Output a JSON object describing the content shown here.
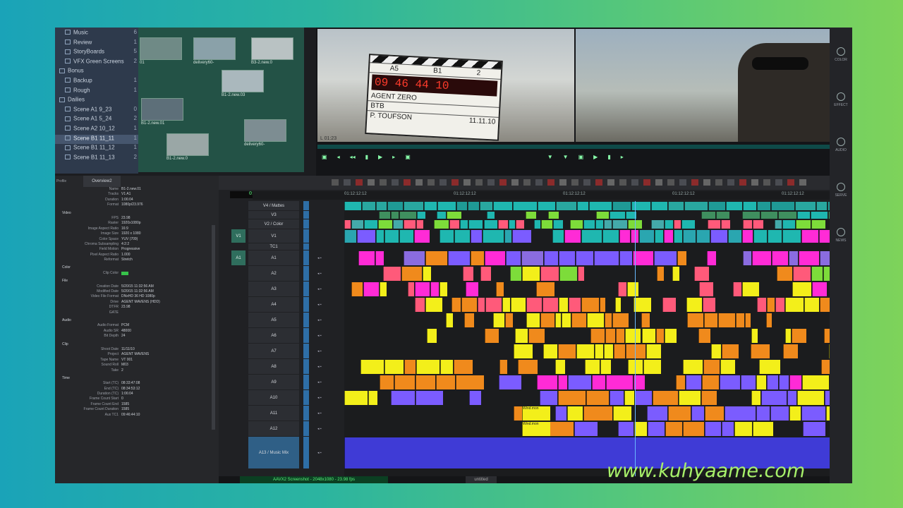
{
  "bins": {
    "items": [
      {
        "label": "Music",
        "count": "6",
        "indent": 1
      },
      {
        "label": "Review",
        "count": "1",
        "indent": 1
      },
      {
        "label": "StoryBoards",
        "count": "5",
        "indent": 1
      },
      {
        "label": "VFX Green Screens",
        "count": "2",
        "indent": 1
      },
      {
        "label": "Bonus",
        "count": "",
        "indent": 0
      },
      {
        "label": "Backup",
        "count": "1",
        "indent": 1
      },
      {
        "label": "Rough",
        "count": "1",
        "indent": 1
      },
      {
        "label": "Dailies",
        "count": "",
        "indent": 0
      },
      {
        "label": "Scene A1 9_23",
        "count": "0",
        "indent": 1
      },
      {
        "label": "Scene A1 5_24",
        "count": "2",
        "indent": 1
      },
      {
        "label": "Scene A2 10_12",
        "count": "1",
        "indent": 1
      },
      {
        "label": "Scene B1 11_11",
        "count": "1",
        "indent": 1,
        "selected": true
      },
      {
        "label": "Scene B1 11_12",
        "count": "1",
        "indent": 1
      },
      {
        "label": "Scene B1 11_13",
        "count": "2",
        "indent": 1
      }
    ]
  },
  "thumbs": [
    {
      "caption": "01"
    },
    {
      "caption": "delivery60-"
    },
    {
      "caption": "B3-2.new.0"
    },
    {
      "caption": "B1-2.new.01"
    },
    {
      "caption": "B1-2.new.03"
    },
    {
      "caption": "delivery60-"
    },
    {
      "caption": "B1-2.new.0"
    }
  ],
  "viewer": {
    "slate": {
      "roll": "A5",
      "scene": "B1",
      "take": "2",
      "timecode": "09 46 44 10",
      "title": "AGENT ZERO",
      "line2": "BTB",
      "director": "P. TOUFSON",
      "date": "11.11.10"
    },
    "src_tc": "L 01:23"
  },
  "rail": [
    "COLOR",
    "EFFECT",
    "AUDIO",
    "SERVE",
    "NEWS"
  ],
  "inspector": {
    "header": {
      "profile_label": "Profile",
      "profile_value": "Overview2"
    },
    "rows": [
      {
        "k": "Name",
        "v": "B1-2.new.01"
      },
      {
        "k": "Tracks",
        "v": "V1 A1"
      },
      {
        "k": "Duration",
        "v": "1:06:04"
      },
      {
        "k": "Format",
        "v": "1080p/23.976"
      },
      {
        "sec": "Video"
      },
      {
        "k": "FPS",
        "v": "23.98"
      },
      {
        "k": "Raster",
        "v": "1920x1080p"
      },
      {
        "k": "Image Aspect Ratio",
        "v": "16:9"
      },
      {
        "k": "Image Size",
        "v": "1920 x 1080"
      },
      {
        "k": "Color Space",
        "v": "YUV (709)"
      },
      {
        "k": "Chroma Subsampling",
        "v": "4:2:2"
      },
      {
        "k": "Field Motion",
        "v": "Progressive"
      },
      {
        "k": "Pixel Aspect Ratio",
        "v": "1.000"
      },
      {
        "k": "Reformat",
        "v": "Stretch"
      },
      {
        "sec": "Color"
      },
      {
        "k": "Clip Color",
        "v": ""
      },
      {
        "sec": "File"
      },
      {
        "k": "Creation Date",
        "v": "5/20/15 11:32:56 AM"
      },
      {
        "k": "Modified Date",
        "v": "5/20/15 11:32:56 AM"
      },
      {
        "k": "Video File Format",
        "v": "DNxHD 36 HD 1080p"
      },
      {
        "k": "Drive",
        "v": "AGENT MAVENS (HDD)"
      },
      {
        "k": "DTFR",
        "v": "23.98"
      },
      {
        "k": "GATE",
        "v": ""
      },
      {
        "sec": "Audio"
      },
      {
        "k": "Audio Format",
        "v": "PCM"
      },
      {
        "k": "Audio SR",
        "v": "48000"
      },
      {
        "k": "Bit Depth",
        "v": "24"
      },
      {
        "sec": "Clip"
      },
      {
        "k": "Shoot Date",
        "v": "11/11/10"
      },
      {
        "k": "Project",
        "v": "AGENT MAVENS"
      },
      {
        "k": "Tape Name",
        "v": "VT 001"
      },
      {
        "k": "Sound Roll",
        "v": "M03"
      },
      {
        "k": "Take",
        "v": "2"
      },
      {
        "sec": "Time"
      },
      {
        "k": "Start (TC)",
        "v": "08:33:47:08"
      },
      {
        "k": "End (TC)",
        "v": "08:34:53:12"
      },
      {
        "k": "Duration (TC)",
        "v": "1:06:04"
      },
      {
        "k": "Frame Count Start",
        "v": "0"
      },
      {
        "k": "Frame Count End",
        "v": "1585"
      },
      {
        "k": "Frame Count Duration",
        "v": "1585"
      },
      {
        "k": "Aux TC1",
        "v": "09:46:44:10"
      }
    ]
  },
  "timeline": {
    "timecode": "01:12:46:09",
    "ruler": [
      "01:12:12:12",
      "01:12:12:12",
      "01:12:12:12",
      "01:12:12:12",
      "01:12:12:12"
    ],
    "ruler2": [
      "01:12:12:12",
      "01:12:12:12",
      "01:12:12:12",
      "01:12:12:12"
    ],
    "tracks": [
      {
        "name": "V4 / Mattes",
        "patch": ""
      },
      {
        "name": "V3",
        "patch": ""
      },
      {
        "name": "V2 / Color",
        "patch": ""
      },
      {
        "name": "V1",
        "patch": "V1"
      },
      {
        "name": "TC1",
        "patch": ""
      },
      {
        "name": "A1",
        "patch": "A1"
      },
      {
        "name": "A2",
        "patch": ""
      },
      {
        "name": "A3",
        "patch": ""
      },
      {
        "name": "A4",
        "patch": ""
      },
      {
        "name": "A5",
        "patch": ""
      },
      {
        "name": "A6",
        "patch": ""
      },
      {
        "name": "A7",
        "patch": ""
      },
      {
        "name": "A8",
        "patch": ""
      },
      {
        "name": "A9",
        "patch": ""
      },
      {
        "name": "A10",
        "patch": ""
      },
      {
        "name": "A11",
        "patch": ""
      },
      {
        "name": "A12",
        "patch": ""
      },
      {
        "name": "A13 / Music Mix",
        "patch": ""
      }
    ],
    "clip_labels": {
      "wind": "Wind.mon"
    },
    "status": "AAVX2 Screenshot - 2048x1080 - 23.98 fps",
    "status_right": "untitled"
  },
  "colors": {
    "purple": "#7b5cff",
    "magenta": "#ff2bd6",
    "yellow": "#f3ef1a",
    "orange": "#f08a1c",
    "teal": "#1fb7b0",
    "green": "#7ddc3a",
    "pink": "#ff5a7a",
    "blue": "#5566ff"
  },
  "watermark": "www.kuhyaame.com"
}
